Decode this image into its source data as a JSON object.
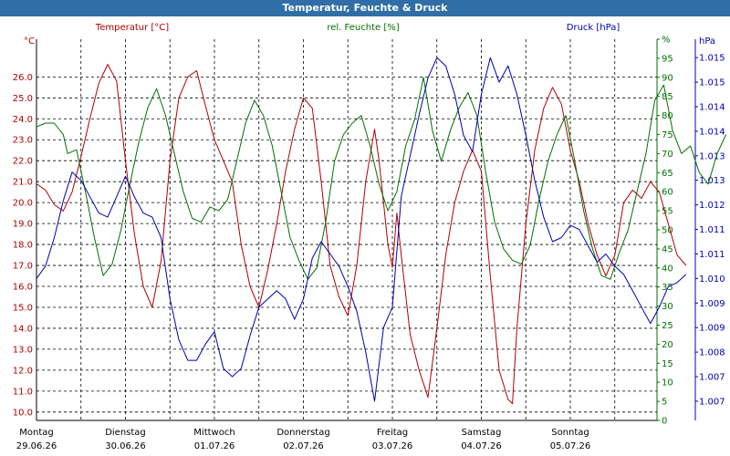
{
  "window": {
    "title": "Temperatur, Feuchte & Druck"
  },
  "chart_data": {
    "type": "line",
    "title": "Temperatur, Feuchte & Druck",
    "xlim": [
      0,
      8
    ],
    "grid": true,
    "colors": {
      "temperature": "#b00000",
      "humidity": "#007000",
      "pressure": "#0000b0",
      "grid": "#000000"
    },
    "x_ticks": [
      {
        "x": 0,
        "day": "Montag",
        "date": "29.06.26"
      },
      {
        "x": 1,
        "day": "Dienstag",
        "date": "30.06.26"
      },
      {
        "x": 2,
        "day": "Mittwoch",
        "date": "01.07.26"
      },
      {
        "x": 3,
        "day": "Donnerstag",
        "date": "02.07.26"
      },
      {
        "x": 4,
        "day": "Freitag",
        "date": "03.07.26"
      },
      {
        "x": 5,
        "day": "Samstag",
        "date": "04.07.26"
      },
      {
        "x": 6,
        "day": "Sonntag",
        "date": "05.07.26"
      }
    ],
    "axes": {
      "left": {
        "unit": "°C",
        "ylim": [
          9.6,
          27.8
        ],
        "ticks": [
          "10.0",
          "11.0",
          "12.0",
          "13.0",
          "14.0",
          "15.0",
          "16.0",
          "17.0",
          "18.0",
          "19.0",
          "20.0",
          "21.0",
          "22.0",
          "23.0",
          "24.0",
          "25.0",
          "26.0"
        ],
        "tick_values": [
          10,
          11,
          12,
          13,
          14,
          15,
          16,
          17,
          18,
          19,
          20,
          21,
          22,
          23,
          24,
          25,
          26
        ]
      },
      "right_humidity": {
        "unit": "%",
        "ylim": [
          0,
          100
        ],
        "ticks": [
          "0",
          "5",
          "10",
          "15",
          "20",
          "25",
          "30",
          "35",
          "40",
          "45",
          "50",
          "55",
          "60",
          "65",
          "70",
          "75",
          "80",
          "85",
          "90",
          "95",
          "%"
        ],
        "tick_values": [
          0,
          5,
          10,
          15,
          20,
          25,
          30,
          35,
          40,
          45,
          50,
          55,
          60,
          65,
          70,
          75,
          80,
          85,
          90,
          95,
          100
        ]
      },
      "right_pressure": {
        "unit": "hPa",
        "ylim": [
          1006.53,
          1015.85
        ],
        "ticks": [
          "1.007",
          "1.007",
          "1.008",
          "1.009",
          "1.009",
          "1.010",
          "1.011",
          "1.011",
          "1.012",
          "1.013",
          "1.013",
          "1.014",
          "1.014",
          "1.015",
          "1.015"
        ],
        "tick_values": [
          1007.0,
          1007.6,
          1008.2,
          1008.8,
          1009.4,
          1010.0,
          1010.6,
          1011.2,
          1011.8,
          1012.4,
          1013.0,
          1013.6,
          1014.2,
          1014.8,
          1015.4
        ]
      }
    },
    "series": [
      {
        "name": "Temperatur [°C]",
        "axis": "left",
        "color": "#b00000",
        "points": [
          [
            0,
            20.9
          ],
          [
            0.1,
            20.6
          ],
          [
            0.2,
            19.9
          ],
          [
            0.3,
            19.6
          ],
          [
            0.4,
            20.5
          ],
          [
            0.5,
            22.2
          ],
          [
            0.6,
            24.0
          ],
          [
            0.7,
            25.7
          ],
          [
            0.8,
            26.6
          ],
          [
            0.9,
            25.8
          ],
          [
            1.0,
            22.0
          ],
          [
            1.1,
            18.5
          ],
          [
            1.2,
            16.0
          ],
          [
            1.3,
            15.0
          ],
          [
            1.4,
            17.2
          ],
          [
            1.5,
            22.0
          ],
          [
            1.6,
            25.0
          ],
          [
            1.7,
            26.0
          ],
          [
            1.8,
            26.3
          ],
          [
            1.9,
            24.6
          ],
          [
            2.0,
            23.0
          ],
          [
            2.1,
            22.0
          ],
          [
            2.2,
            21.0
          ],
          [
            2.3,
            18.0
          ],
          [
            2.4,
            16.0
          ],
          [
            2.5,
            15.0
          ],
          [
            2.6,
            16.8
          ],
          [
            2.7,
            19.0
          ],
          [
            2.8,
            21.5
          ],
          [
            2.9,
            23.5
          ],
          [
            3.0,
            25.0
          ],
          [
            3.1,
            24.5
          ],
          [
            3.2,
            21.0
          ],
          [
            3.3,
            17.0
          ],
          [
            3.4,
            15.5
          ],
          [
            3.5,
            14.6
          ],
          [
            3.6,
            17.0
          ],
          [
            3.7,
            21.0
          ],
          [
            3.8,
            23.5
          ],
          [
            3.85,
            22.0
          ],
          [
            3.9,
            20.0
          ],
          [
            3.95,
            18.0
          ],
          [
            4.0,
            16.9
          ],
          [
            4.05,
            19.5
          ],
          [
            4.1,
            17.5
          ],
          [
            4.2,
            13.7
          ],
          [
            4.3,
            12.0
          ],
          [
            4.4,
            10.7
          ],
          [
            4.5,
            14.0
          ],
          [
            4.6,
            17.5
          ],
          [
            4.7,
            20.0
          ],
          [
            4.8,
            21.5
          ],
          [
            4.9,
            22.5
          ],
          [
            5.0,
            21.5
          ],
          [
            5.1,
            16.5
          ],
          [
            5.2,
            12.0
          ],
          [
            5.3,
            10.6
          ],
          [
            5.35,
            10.4
          ],
          [
            5.4,
            14.0
          ],
          [
            5.5,
            19.0
          ],
          [
            5.6,
            22.5
          ],
          [
            5.7,
            24.5
          ],
          [
            5.8,
            25.5
          ],
          [
            5.9,
            24.7
          ],
          [
            6.0,
            22.5
          ],
          [
            6.1,
            21.0
          ],
          [
            6.2,
            19.0
          ],
          [
            6.3,
            17.5
          ],
          [
            6.4,
            16.5
          ],
          [
            6.5,
            17.5
          ],
          [
            6.6,
            20.0
          ],
          [
            6.7,
            20.6
          ],
          [
            6.8,
            20.2
          ],
          [
            6.9,
            21.0
          ],
          [
            7.0,
            20.5
          ],
          [
            7.1,
            19.0
          ],
          [
            7.2,
            17.5
          ],
          [
            7.3,
            17.0
          ]
        ]
      },
      {
        "name": "rel. Feuchte [%]",
        "axis": "right_humidity",
        "color": "#007000",
        "points": [
          [
            0,
            77
          ],
          [
            0.1,
            78
          ],
          [
            0.2,
            78
          ],
          [
            0.3,
            75
          ],
          [
            0.35,
            70
          ],
          [
            0.45,
            71
          ],
          [
            0.55,
            60
          ],
          [
            0.65,
            48
          ],
          [
            0.75,
            38
          ],
          [
            0.85,
            41
          ],
          [
            0.95,
            50
          ],
          [
            1.05,
            62
          ],
          [
            1.15,
            73
          ],
          [
            1.25,
            82
          ],
          [
            1.35,
            87
          ],
          [
            1.45,
            80
          ],
          [
            1.55,
            70
          ],
          [
            1.65,
            60
          ],
          [
            1.75,
            53
          ],
          [
            1.85,
            52
          ],
          [
            1.95,
            56
          ],
          [
            2.05,
            55
          ],
          [
            2.15,
            58
          ],
          [
            2.25,
            68
          ],
          [
            2.35,
            78
          ],
          [
            2.45,
            84
          ],
          [
            2.55,
            80
          ],
          [
            2.65,
            72
          ],
          [
            2.75,
            60
          ],
          [
            2.85,
            48
          ],
          [
            2.95,
            42
          ],
          [
            3.05,
            37
          ],
          [
            3.15,
            40
          ],
          [
            3.25,
            52
          ],
          [
            3.35,
            68
          ],
          [
            3.45,
            75
          ],
          [
            3.55,
            78
          ],
          [
            3.65,
            80
          ],
          [
            3.75,
            72
          ],
          [
            3.85,
            62
          ],
          [
            3.95,
            55
          ],
          [
            4.05,
            60
          ],
          [
            4.15,
            72
          ],
          [
            4.25,
            79
          ],
          [
            4.35,
            90
          ],
          [
            4.45,
            76
          ],
          [
            4.55,
            68
          ],
          [
            4.65,
            76
          ],
          [
            4.75,
            82
          ],
          [
            4.85,
            86
          ],
          [
            4.95,
            80
          ],
          [
            5.05,
            65
          ],
          [
            5.15,
            52
          ],
          [
            5.25,
            45
          ],
          [
            5.35,
            42
          ],
          [
            5.45,
            41
          ],
          [
            5.55,
            46
          ],
          [
            5.65,
            58
          ],
          [
            5.75,
            68
          ],
          [
            5.85,
            75
          ],
          [
            5.95,
            80
          ],
          [
            6.05,
            68
          ],
          [
            6.15,
            55
          ],
          [
            6.25,
            45
          ],
          [
            6.35,
            38
          ],
          [
            6.45,
            37
          ],
          [
            6.55,
            44
          ],
          [
            6.65,
            50
          ],
          [
            6.75,
            60
          ],
          [
            6.85,
            70
          ],
          [
            6.95,
            84
          ],
          [
            7.05,
            88
          ],
          [
            7.15,
            76
          ],
          [
            7.25,
            70
          ],
          [
            7.35,
            72
          ],
          [
            7.45,
            65
          ],
          [
            7.55,
            62
          ],
          [
            7.65,
            70
          ],
          [
            7.75,
            75
          ]
        ]
      },
      {
        "name": "Druck [hPa]",
        "axis": "right_pressure",
        "color": "#0000b0",
        "points": [
          [
            0,
            1010.0
          ],
          [
            0.1,
            1010.3
          ],
          [
            0.2,
            1011.0
          ],
          [
            0.3,
            1011.9
          ],
          [
            0.4,
            1012.6
          ],
          [
            0.5,
            1012.4
          ],
          [
            0.6,
            1012.0
          ],
          [
            0.7,
            1011.6
          ],
          [
            0.8,
            1011.5
          ],
          [
            0.9,
            1012.0
          ],
          [
            1.0,
            1012.5
          ],
          [
            1.1,
            1012.0
          ],
          [
            1.2,
            1011.6
          ],
          [
            1.3,
            1011.5
          ],
          [
            1.4,
            1011.0
          ],
          [
            1.5,
            1009.5
          ],
          [
            1.6,
            1008.5
          ],
          [
            1.7,
            1008.0
          ],
          [
            1.8,
            1008.0
          ],
          [
            1.9,
            1008.4
          ],
          [
            2.0,
            1008.7
          ],
          [
            2.1,
            1007.8
          ],
          [
            2.2,
            1007.6
          ],
          [
            2.3,
            1007.8
          ],
          [
            2.4,
            1008.6
          ],
          [
            2.5,
            1009.3
          ],
          [
            2.6,
            1009.5
          ],
          [
            2.7,
            1009.7
          ],
          [
            2.8,
            1009.5
          ],
          [
            2.9,
            1009.0
          ],
          [
            3.0,
            1009.5
          ],
          [
            3.1,
            1010.5
          ],
          [
            3.2,
            1010.9
          ],
          [
            3.3,
            1010.6
          ],
          [
            3.4,
            1010.3
          ],
          [
            3.5,
            1009.8
          ],
          [
            3.6,
            1009.2
          ],
          [
            3.7,
            1008.2
          ],
          [
            3.8,
            1007.0
          ],
          [
            3.9,
            1008.8
          ],
          [
            4.0,
            1009.3
          ],
          [
            4.1,
            1012.0
          ],
          [
            4.2,
            1013.0
          ],
          [
            4.3,
            1014.0
          ],
          [
            4.4,
            1014.9
          ],
          [
            4.5,
            1015.4
          ],
          [
            4.6,
            1015.2
          ],
          [
            4.7,
            1014.5
          ],
          [
            4.8,
            1013.5
          ],
          [
            4.9,
            1013.1
          ],
          [
            5.0,
            1014.5
          ],
          [
            5.1,
            1015.4
          ],
          [
            5.2,
            1014.8
          ],
          [
            5.3,
            1015.2
          ],
          [
            5.4,
            1014.5
          ],
          [
            5.5,
            1013.5
          ],
          [
            5.6,
            1012.4
          ],
          [
            5.7,
            1011.5
          ],
          [
            5.8,
            1010.9
          ],
          [
            5.9,
            1011.0
          ],
          [
            6.0,
            1011.3
          ],
          [
            6.1,
            1011.2
          ],
          [
            6.2,
            1010.8
          ],
          [
            6.3,
            1010.4
          ],
          [
            6.4,
            1010.6
          ],
          [
            6.5,
            1010.3
          ],
          [
            6.6,
            1010.1
          ],
          [
            6.7,
            1009.7
          ],
          [
            6.8,
            1009.3
          ],
          [
            6.9,
            1008.9
          ],
          [
            7.0,
            1009.3
          ],
          [
            7.1,
            1009.8
          ],
          [
            7.2,
            1009.9
          ],
          [
            7.3,
            1010.1
          ]
        ]
      }
    ]
  }
}
